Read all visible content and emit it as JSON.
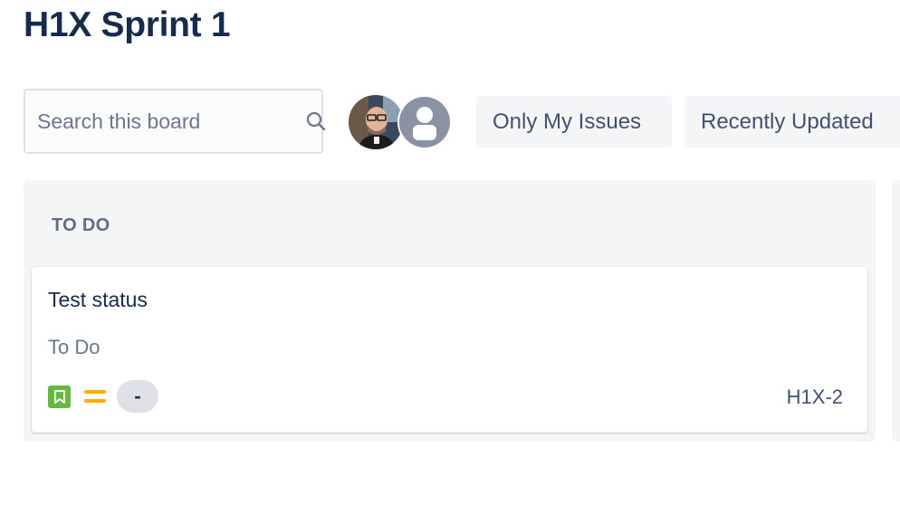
{
  "board": {
    "title": "H1X Sprint 1"
  },
  "toolbar": {
    "search_placeholder": "Search this board",
    "search_value": "",
    "search_icon": "search-icon",
    "avatars": [
      {
        "name": "user-avatar-photo"
      },
      {
        "name": "user-avatar-default"
      }
    ],
    "filters": [
      {
        "label": "Only My Issues"
      },
      {
        "label": "Recently Updated"
      }
    ]
  },
  "columns": [
    {
      "header": "TO DO",
      "cards": [
        {
          "summary": "Test status",
          "status": "To Do",
          "issue_type_icon": "story-icon",
          "priority_icon": "medium-priority-icon",
          "estimate": "-",
          "key": "H1X-2"
        }
      ]
    }
  ],
  "colors": {
    "title": "#172b4d",
    "column_bg": "#f4f5f7",
    "story": "#63ba3c",
    "priority_medium": "#ffab00"
  }
}
